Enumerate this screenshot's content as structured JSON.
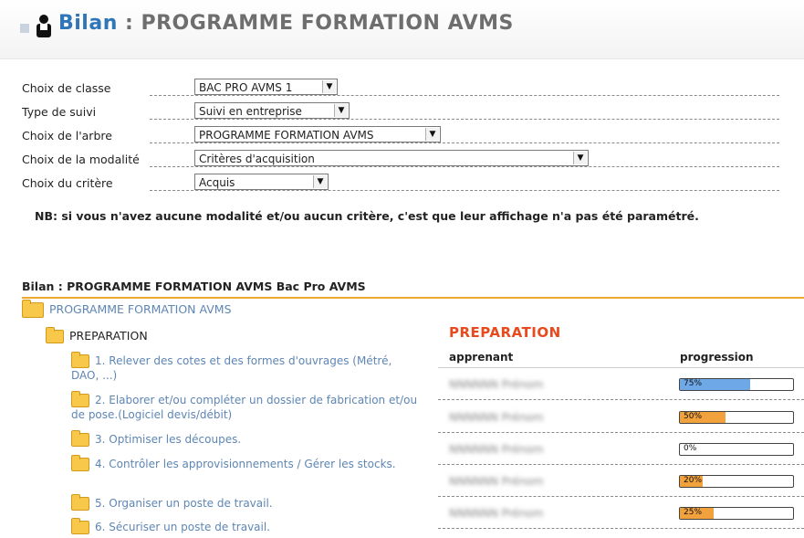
{
  "header": {
    "title_prefix": "Bilan",
    "title_rest": " : PROGRAMME FORMATION AVMS"
  },
  "form": {
    "classe": {
      "label": "Choix de classe",
      "value": "BAC PRO AVMS 1"
    },
    "suivi": {
      "label": "Type de suivi",
      "value": "Suivi en entreprise"
    },
    "arbre": {
      "label": "Choix de l'arbre",
      "value": "PROGRAMME FORMATION AVMS"
    },
    "modalite": {
      "label": "Choix de la modalité",
      "value": "Critères d'acquisition"
    },
    "critere": {
      "label": "Choix du critère",
      "value": "Acquis"
    }
  },
  "note": "NB: si vous n'avez aucune modalité et/ou aucun critère, c'est que leur affichage n'a pas été paramétré.",
  "bilan": {
    "title": "Bilan : PROGRAMME FORMATION AVMS Bac Pro AVMS",
    "root": "PROGRAMME FORMATION AVMS",
    "section": "PREPARATION",
    "items": [
      "1. Relever des cotes et des formes d'ouvrages (Métré, DAO, ...)",
      "2. Elaborer et/ou compléter un dossier de fabrication et/ou de pose.(Logiciel devis/débit)",
      "3. Optimiser les découpes.",
      "4. Contrôler les approvisionnements / Gérer les stocks.",
      "5. Organiser un poste de travail.",
      "6. Sécuriser un poste de travail."
    ]
  },
  "table": {
    "heading": "PREPARATION",
    "col_apprenant": "apprenant",
    "col_progression": "progression",
    "rows": [
      {
        "student": "NNNNNN Prénom",
        "bar_text": "75%",
        "fill": 0.62,
        "color": "#6fa8e6"
      },
      {
        "student": "NNNNNN Prénom",
        "bar_text": "50%",
        "fill": 0.4,
        "color": "#f2a23c"
      },
      {
        "student": "NNNNNN Prénom",
        "bar_text": "0%",
        "fill": 0.0,
        "color": "#f2a23c"
      },
      {
        "student": "NNNNNN Prénom",
        "bar_text": "20%",
        "fill": 0.2,
        "color": "#f2a23c"
      },
      {
        "student": "NNNNNN Prénom",
        "bar_text": "25%",
        "fill": 0.3,
        "color": "#f2a23c"
      }
    ]
  }
}
